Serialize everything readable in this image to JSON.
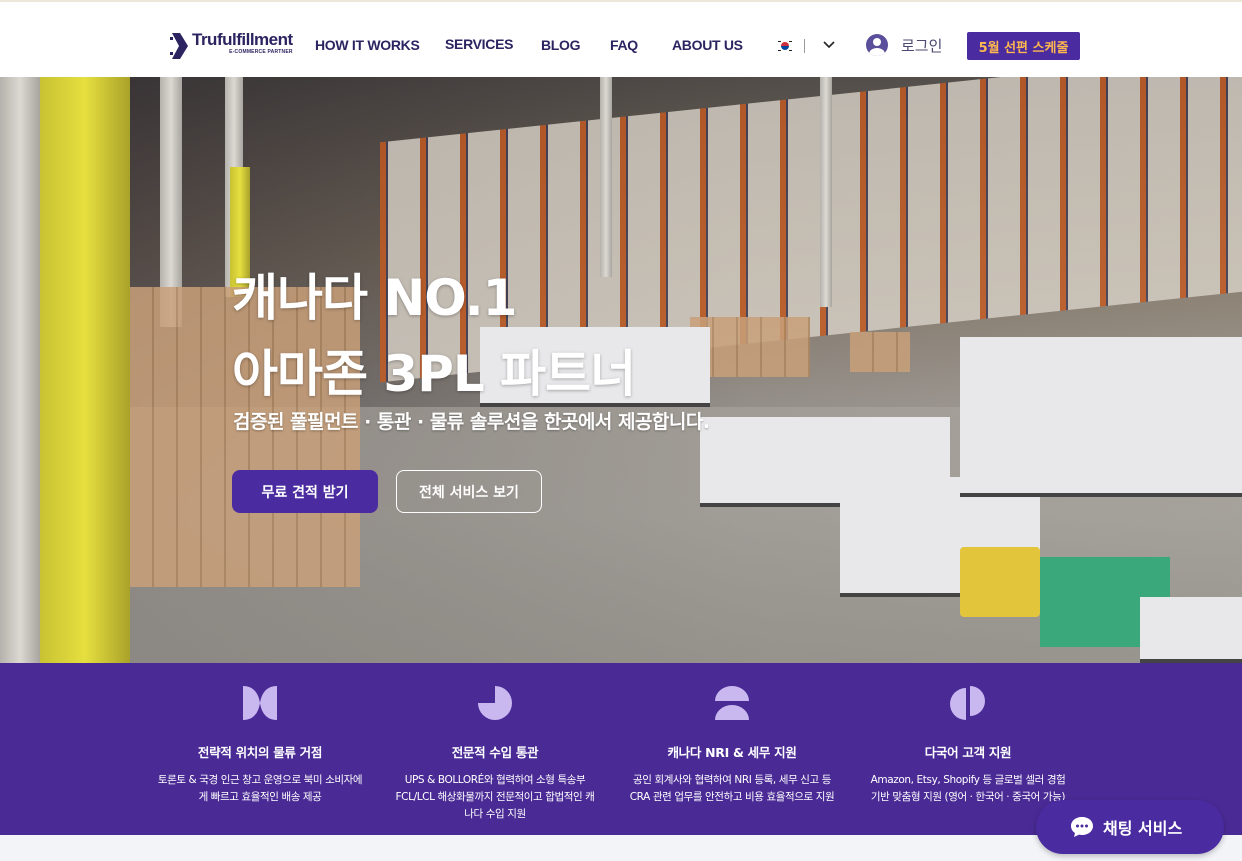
{
  "header": {
    "logo_name": "Trufulfillment",
    "logo_tag": "E-COMMERCE PARTNER",
    "nav": [
      "HOW IT WORKS",
      "SERVICES",
      "BLOG",
      "FAQ",
      "ABOUT US"
    ],
    "login_label": "로그인",
    "cta_label": "5월 선편 스케줄"
  },
  "hero": {
    "title_line1": "캐나다 NO.1",
    "title_line2": "아마존 3PL 파트너",
    "subtitle": "검증된 풀필먼트 · 통관 · 물류 솔루션을 한곳에서 제공합니다.",
    "primary_button": "무료 견적 받기",
    "secondary_button": "전체 서비스 보기"
  },
  "features": [
    {
      "icon": "bowtie-icon",
      "title": "전략적 위치의 물류 거점",
      "desc": "토론토 & 국경 인근 창고 운영으로 북미 소비자에게 빠르고 효율적인 배송 제공"
    },
    {
      "icon": "pie-quarter-icon",
      "title": "전문적 수입 통관",
      "desc": "UPS & BOLLORÉ와 협력하여 소형 특송부 FCL/LCL 해상화물까지 전문적이고 합법적인 캐나다 수입 지원"
    },
    {
      "icon": "dome-icon",
      "title": "캐나다 NRI & 세무 지원",
      "desc": "공인 회계사와 협력하여 NRI 등록, 세무 신고 등 CRA 관련 업무를 안전하고 비용 효율적으로 지원"
    },
    {
      "icon": "split-circle-icon",
      "title": "다국어 고객 지원",
      "desc": "Amazon, Etsy, Shopify 등 글로벌 셀러 경험 기반 맞춤형 지원 (영어 · 한국어 · 중국어 가능)"
    }
  ],
  "chat": {
    "label": "채팅 서비스"
  },
  "colors": {
    "brand": "#4a2ba0",
    "accent": "#ffb84d",
    "navy": "#2b2461"
  }
}
